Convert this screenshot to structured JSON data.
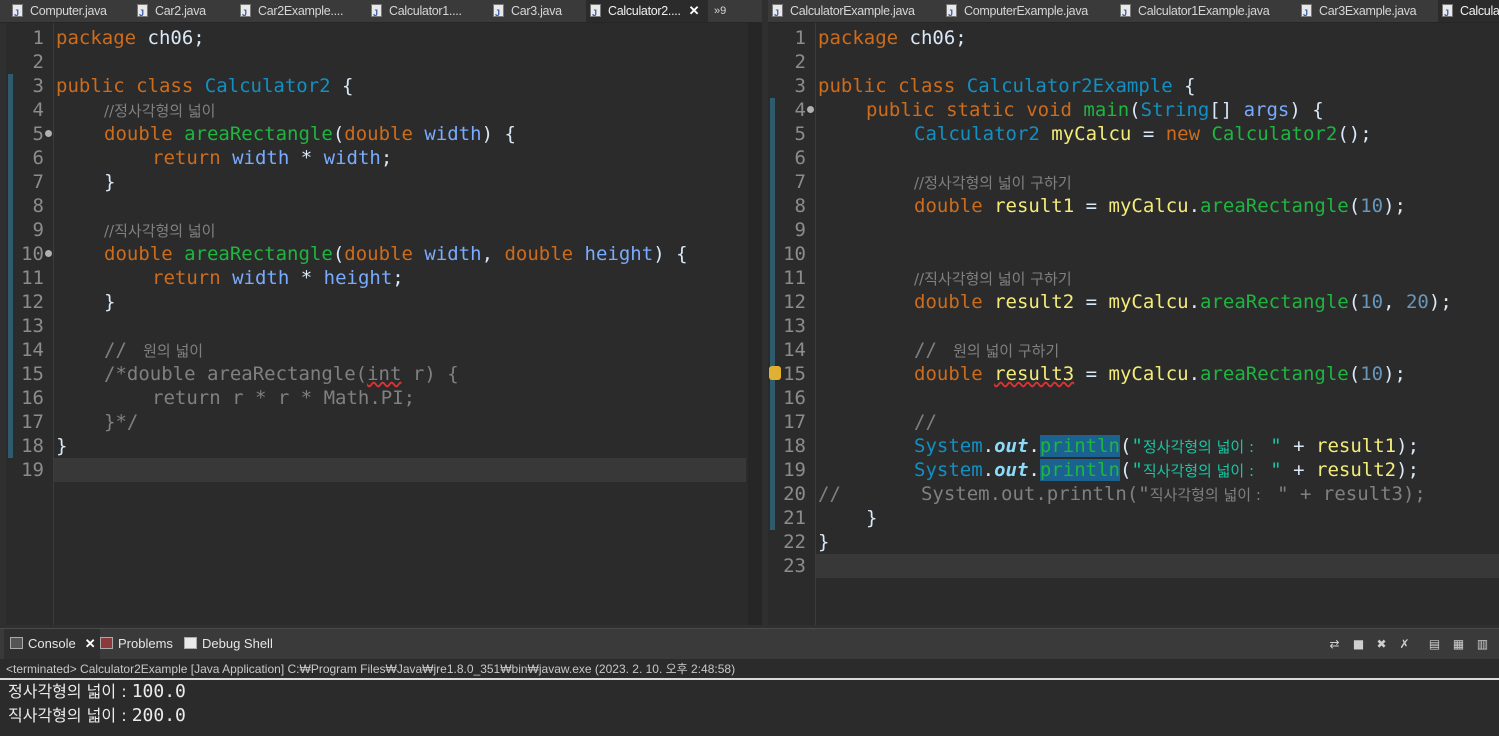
{
  "left_editor": {
    "tabs": [
      {
        "label": "Computer.java",
        "active": false
      },
      {
        "label": "Car2.java",
        "active": false
      },
      {
        "label": "Car2Example....",
        "active": false
      },
      {
        "label": "Calculator1....",
        "active": false
      },
      {
        "label": "Car3.java",
        "active": false
      },
      {
        "label": "Calculator2....",
        "active": true
      }
    ],
    "tab_close": "✕",
    "overflow": "»9",
    "line_numbers": [
      "1",
      "2",
      "3",
      "4",
      "5",
      "6",
      "7",
      "8",
      "9",
      "10",
      "11",
      "12",
      "13",
      "14",
      "15",
      "16",
      "17",
      "18",
      "19"
    ],
    "code": {
      "l1_kw": "package",
      "l1_rest": " ch06;",
      "l3_kw1": "public",
      "l3_kw2": "class",
      "l3_name": "Calculator2",
      "l3_rest": " {",
      "l4_comment": "//정사각형의 넓이",
      "l5_kw": "double",
      "l5_fn": "areaRectangle",
      "l5_open": "(",
      "l5_kw2": "double",
      "l5_p1": "width",
      "l5_close": ") {",
      "l6_kw": "return",
      "l6_p1": "width",
      "l6_op": " * ",
      "l6_p2": "width",
      "l6_end": ";",
      "l7": "}",
      "l9_comment": "//직사각형의 넓이",
      "l10_kw": "double",
      "l10_fn": "areaRectangle",
      "l10_open": "(",
      "l10_kw2": "double",
      "l10_p1": "width",
      "l10_comma": ", ",
      "l10_kw3": "double",
      "l10_p2": "height",
      "l10_close": ") {",
      "l11_kw": "return",
      "l11_p1": "width",
      "l11_op": " * ",
      "l11_p2": "height",
      "l11_end": ";",
      "l12": "}",
      "l14_a": "// ",
      "l14_ko": " 원의 넓이",
      "l15_a": "/*double areaRectangle(",
      "l15_int": "int",
      "l15_b": " r) {",
      "l16": "return r * r * Math.PI;",
      "l17": "}*/",
      "l18": "}"
    }
  },
  "right_editor": {
    "tabs": [
      {
        "label": "CalculatorExample.java",
        "active": false
      },
      {
        "label": "ComputerExample.java",
        "active": false
      },
      {
        "label": "Calculator1Example.java",
        "active": false
      },
      {
        "label": "Car3Example.java",
        "active": false
      },
      {
        "label": "Calcula",
        "active": true
      }
    ],
    "line_numbers": [
      "1",
      "2",
      "3",
      "4",
      "5",
      "6",
      "7",
      "8",
      "9",
      "10",
      "11",
      "12",
      "13",
      "14",
      "15",
      "16",
      "17",
      "18",
      "19",
      "20",
      "21",
      "22",
      "23"
    ],
    "code": {
      "l1_kw": "package",
      "l1_rest": " ch06;",
      "l3_kw1": "public",
      "l3_kw2": "class",
      "l3_name": "Calculator2Example",
      "l3_rest": " {",
      "l4_kw1": "public",
      "l4_kw2": "static",
      "l4_kw3": "void",
      "l4_fn": "main",
      "l4_open": "(",
      "l4_type": "String",
      "l4_arr": "[] ",
      "l4_p": "args",
      "l4_close": ") {",
      "l5_type": "Calculator2",
      "l5_var": "myCalcu",
      "l5_eq": " = ",
      "l5_kw": "new",
      "l5_ctor": "Calculator2",
      "l5_end": "();",
      "l7_comment": "//정사각형의 넓이 구하기",
      "l8_kw": "double",
      "l8_var": "result1",
      "l8_eq": " = ",
      "l8_obj": "myCalcu",
      "l8_dot": ".",
      "l8_fn": "areaRectangle",
      "l8_open": "(",
      "l8_n1": "10",
      "l8_end": ");",
      "l11_comment": "//직사각형의 넓이 구하기",
      "l12_kw": "double",
      "l12_var": "result2",
      "l12_eq": " = ",
      "l12_obj": "myCalcu",
      "l12_dot": ".",
      "l12_fn": "areaRectangle",
      "l12_open": "(",
      "l12_n1": "10",
      "l12_comma": ", ",
      "l12_n2": "20",
      "l12_end": ");",
      "l14_a": "// ",
      "l14_ko": " 원의 넓이 구하기",
      "l15_kw": "double",
      "l15_var": "result3",
      "l15_eq": " = ",
      "l15_obj": "myCalcu",
      "l15_dot": ".",
      "l15_fn": "areaRectangle",
      "l15_open": "(",
      "l15_n1": "10",
      "l15_end": ");",
      "l17": "//",
      "l18_sys": "System",
      "l18_dot": ".",
      "l18_out": "out",
      "l18_dot2": ".",
      "l18_fn": "println",
      "l18_open": "(",
      "l18_q1": "\"",
      "l18_ko": "정사각형의 넓이 : ",
      "l18_q2": " \"",
      "l18_plus": " + ",
      "l18_var": "result1",
      "l18_end": ");",
      "l19_sys": "System",
      "l19_dot": ".",
      "l19_out": "out",
      "l19_dot2": ".",
      "l19_fn": "println",
      "l19_open": "(",
      "l19_q1": "\"",
      "l19_ko": "직사각형의 넓이 : ",
      "l19_q2": " \"",
      "l19_plus": " + ",
      "l19_var": "result2",
      "l19_end": ");",
      "l20_a": "//       System.out.println(\"",
      "l20_ko": "직사각형의 넓이 : ",
      "l20_b": " \" + result3);",
      "l21": "}",
      "l22": "}"
    }
  },
  "console": {
    "tabs": [
      {
        "label": "Console",
        "active": true
      },
      {
        "label": "Problems",
        "active": false
      },
      {
        "label": "Debug Shell",
        "active": false
      }
    ],
    "close": "✕",
    "status": "<terminated> Calculator2Example [Java Application] C:₩Program Files₩Java₩jre1.8.0_351₩bin₩javaw.exe  (2023. 2. 10. 오후 2:48:58)",
    "output": [
      {
        "label": "정사각형의 넓이 : ",
        "value": "100.0"
      },
      {
        "label": "직사각형의 넓이 : ",
        "value": "200.0"
      }
    ]
  }
}
